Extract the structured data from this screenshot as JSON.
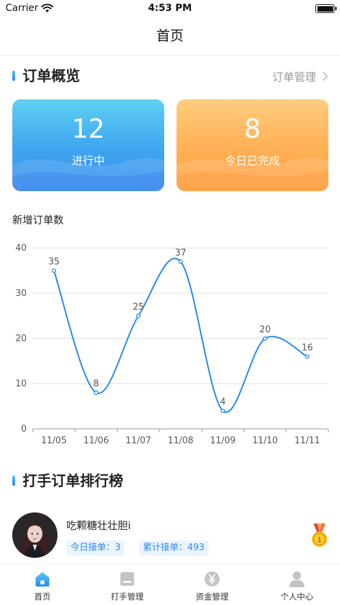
{
  "status_bar": {
    "carrier": "Carrier",
    "time": "4:53 PM"
  },
  "nav": {
    "title": "首页"
  },
  "order_overview": {
    "title": "订单概览",
    "link_label": "订单管理",
    "cards": [
      {
        "value": "12",
        "label": "进行中",
        "color": "#3ea5f0"
      },
      {
        "value": "8",
        "label": "今日已完成",
        "color": "#ffa94a"
      }
    ]
  },
  "new_orders": {
    "title": "新增订单数"
  },
  "chart_data": {
    "type": "line",
    "categories": [
      "11/05",
      "11/06",
      "11/07",
      "11/08",
      "11/09",
      "11/10",
      "11/11"
    ],
    "values": [
      35,
      8,
      25,
      37,
      4,
      20,
      16
    ],
    "data_labels": [
      "35",
      "8",
      "25",
      "37",
      "4",
      "20",
      "16"
    ],
    "ylim": [
      0,
      40
    ],
    "yticks": [
      "0",
      "10",
      "20",
      "30",
      "40"
    ],
    "smooth": true,
    "grid": true,
    "line_color": "#1e88f0"
  },
  "ranking": {
    "title": "打手订单排行榜",
    "items": [
      {
        "name": "吃颗糖壮壮胆i",
        "today": "今日接单：3",
        "total": "累计接单：493",
        "medal": "medal-icon"
      }
    ]
  },
  "tab_bar": {
    "items": [
      {
        "label": "首页",
        "icon": "home-icon",
        "active": true
      },
      {
        "label": "打手管理",
        "icon": "folder-icon",
        "active": false
      },
      {
        "label": "资金管理",
        "icon": "yen-coin-icon",
        "active": false
      },
      {
        "label": "个人中心",
        "icon": "person-icon",
        "active": false
      }
    ],
    "active_color": "#2b8bf2",
    "inactive_color": "#c4c4c4"
  }
}
